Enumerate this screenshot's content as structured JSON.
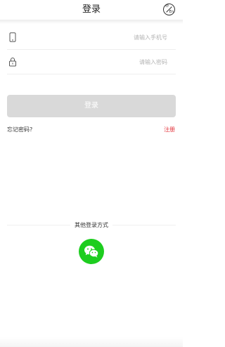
{
  "header": {
    "title": "登录",
    "lang_switch": {
      "icon": "language-switch-icon",
      "zh": "中",
      "en": "En"
    }
  },
  "form": {
    "phone": {
      "icon": "phone-icon",
      "placeholder": "请输入手机号",
      "value": ""
    },
    "password": {
      "icon": "lock-icon",
      "placeholder": "请输入密码",
      "value": ""
    },
    "login_label": "登录"
  },
  "links": {
    "forgot": "忘记密码?",
    "register": "注册"
  },
  "other_login": {
    "label": "其他登录方式",
    "providers": [
      {
        "icon": "wechat-icon"
      }
    ]
  },
  "colors": {
    "register": "#e3353d",
    "wechat": "#1dcd1f",
    "login_button_disabled": "#d9d9d9"
  }
}
